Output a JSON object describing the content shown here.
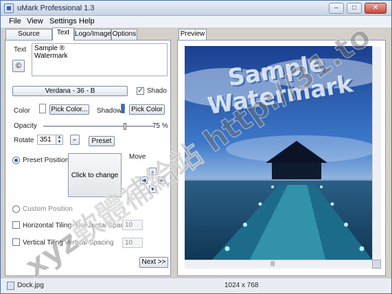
{
  "window": {
    "title": "uMark Professional 1.3",
    "buttons": [
      "–",
      "□",
      "✕"
    ]
  },
  "menu": [
    "File",
    "View",
    "Settings",
    "Help"
  ],
  "tabs": [
    {
      "label": "Source Images",
      "active": false
    },
    {
      "label": "Text",
      "active": true
    },
    {
      "label": "Logo/Image",
      "active": false
    },
    {
      "label": "Options",
      "active": false
    }
  ],
  "text_panel": {
    "text_label": "Text",
    "copyright_symbol": "©",
    "text_lines": [
      "Sample ®",
      "Watermark"
    ],
    "font_button": "Verdana - 36 - B",
    "shadow_checkbox_label": "Shado",
    "shadow_checked": true,
    "color_label": "Color",
    "pick_color_1": "Pick Color...",
    "shadow_label": "Shadow",
    "pick_color_2": "Pick Color",
    "opacity_label": "Opacity",
    "opacity_value": "75",
    "opacity_unit": "%",
    "opacity_fraction": 0.75,
    "rotate_label": "Rotate",
    "rotate_value": "351",
    "preset_button": "Preset",
    "preset_position_label": "Preset Position",
    "click_to_change": "Click to change",
    "move_label": "Move",
    "custom_position_label": "Custom Position",
    "h_tiling_label": "Horizontal Tiling",
    "h_spacing_label": "Horizontal Spacing",
    "h_spacing_value": "10",
    "v_tiling_label": "Vertical Tiling",
    "v_spacing_label": "Vertical Spacing",
    "v_spacing_value": "10",
    "next_button": "Next >>"
  },
  "preview": {
    "tab_label": "Preview",
    "watermark_lines": [
      "Sample",
      "Watermark"
    ],
    "scroll_grip": "|||"
  },
  "status": {
    "filename": "Dock.jpg",
    "dimensions": "1024 x 768"
  },
  "overlay_watermark": "xyz軟體補給站 http://31.to",
  "colors": {
    "swatch_text": "#ffffff",
    "swatch_shadow": "#2f6fc7",
    "accent": "#2c59a8"
  },
  "icons": [
    "app-icon",
    "copyright-icon",
    "arrow-icons",
    "file-icon",
    "zoom-icon"
  ]
}
